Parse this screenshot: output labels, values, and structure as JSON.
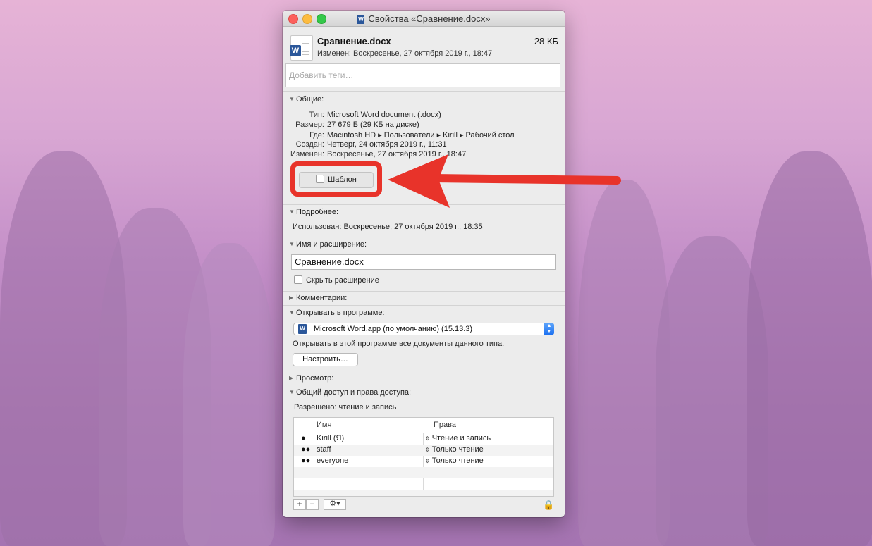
{
  "window": {
    "title": "Свойства «Сравнение.docx»",
    "doc_icon_letter": "W"
  },
  "file": {
    "name": "Сравнение.docx",
    "size": "28 КБ",
    "modified_line": "Изменен: Воскресенье, 27 октября 2019 г., 18:47"
  },
  "tags": {
    "placeholder": "Добавить теги…"
  },
  "general": {
    "header": "Общие:",
    "rows": [
      {
        "label": "Тип:",
        "value": "Microsoft Word document (.docx)"
      },
      {
        "label": "Размер:",
        "value": "27 679 Б (29 КБ на диске)"
      },
      {
        "label": "Где:",
        "value": "Macintosh HD ▸ Пользователи ▸ Kirill ▸ Рабочий стол"
      },
      {
        "label": "Создан:",
        "value": "Четверг, 24 октября 2019 г., 11:31"
      },
      {
        "label": "Изменен:",
        "value": "Воскресенье, 27 октября 2019 г., 18:47"
      }
    ],
    "template_label": "Шаблон"
  },
  "more_info": {
    "header": "Подробнее:",
    "used": "Использован: Воскресенье, 27 октября 2019 г., 18:35"
  },
  "name_ext": {
    "header": "Имя и расширение:",
    "value": "Сравнение.docx",
    "hide_ext_label": "Скрыть расширение"
  },
  "comments": {
    "header": "Комментарии:"
  },
  "open_with": {
    "header": "Открывать в программе:",
    "app": "Microsoft Word.app (по умолчанию) (15.13.3)",
    "note": "Открывать в этой программе все документы данного типа.",
    "configure_label": "Настроить…"
  },
  "preview": {
    "header": "Просмотр:"
  },
  "sharing": {
    "header": "Общий доступ и права доступа:",
    "summary": "Разрешено: чтение и запись",
    "columns": [
      "Имя",
      "Права"
    ],
    "rows": [
      {
        "name": "Kirill (Я)",
        "perm": "Чтение и запись",
        "icon": "user-icon"
      },
      {
        "name": "staff",
        "perm": "Только чтение",
        "icon": "group-icon"
      },
      {
        "name": "everyone",
        "perm": "Только чтение",
        "icon": "everyone-icon"
      }
    ],
    "add_label": "+",
    "remove_label": "−",
    "gear_label": "⚙▾"
  },
  "colors": {
    "annotation": "#e8332a",
    "word_blue": "#2b579a",
    "select_blue": "#1a6ef0"
  }
}
